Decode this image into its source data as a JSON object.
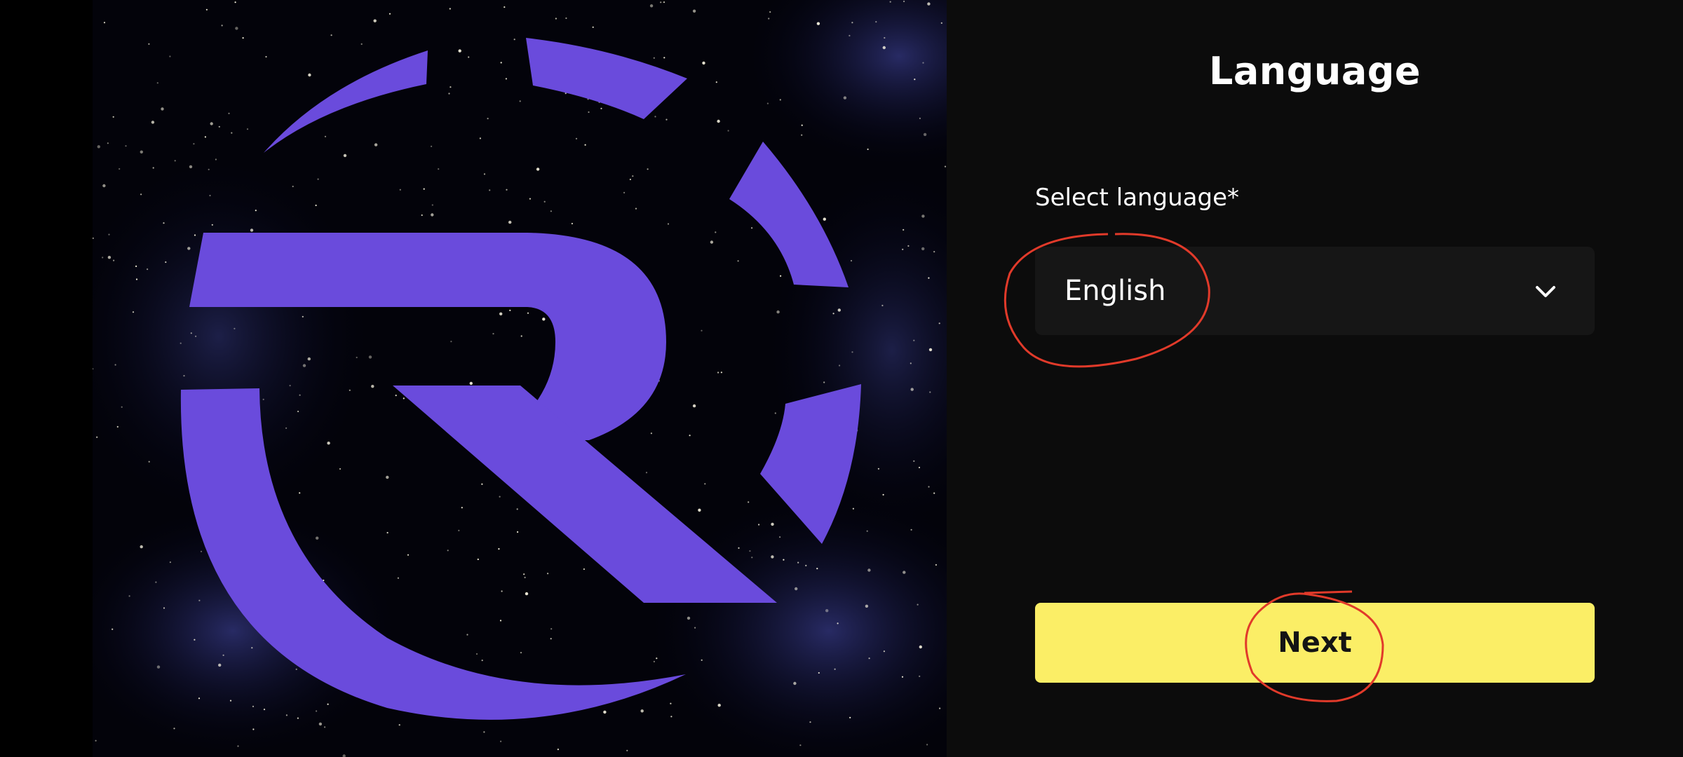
{
  "hero": {
    "logo_name": "r-circle-logo",
    "logo_color": "#6a4bdc",
    "background": "starfield"
  },
  "panel": {
    "title": "Language",
    "field_label": "Select language*",
    "language_select": {
      "value": "English",
      "icon": "chevron-down-icon"
    },
    "next_label": "Next"
  },
  "colors": {
    "accent_button": "#fbee66",
    "panel_background": "#0c0c0c",
    "select_background": "#161616",
    "annotation_marker": "#e13a2a"
  }
}
